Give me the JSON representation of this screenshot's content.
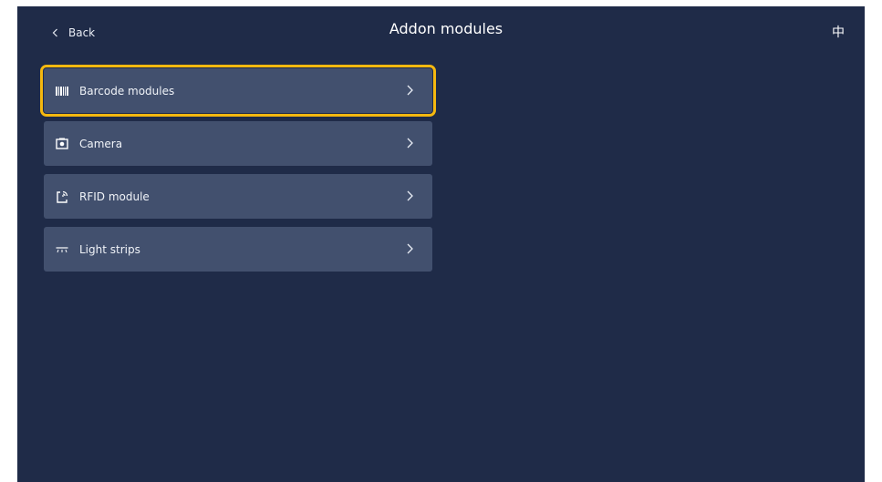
{
  "header": {
    "back_label": "Back",
    "title": "Addon modules",
    "language_label": "中"
  },
  "modules": [
    {
      "label": "Barcode modules",
      "icon": "barcode-icon",
      "selected": true
    },
    {
      "label": "Camera",
      "icon": "camera-icon",
      "selected": false
    },
    {
      "label": "RFID module",
      "icon": "rfid-icon",
      "selected": false
    },
    {
      "label": "Light strips",
      "icon": "light-strip-icon",
      "selected": false
    }
  ],
  "colors": {
    "background": "#1f2b48",
    "row": "#42506e",
    "selection": "#f5b80f"
  }
}
